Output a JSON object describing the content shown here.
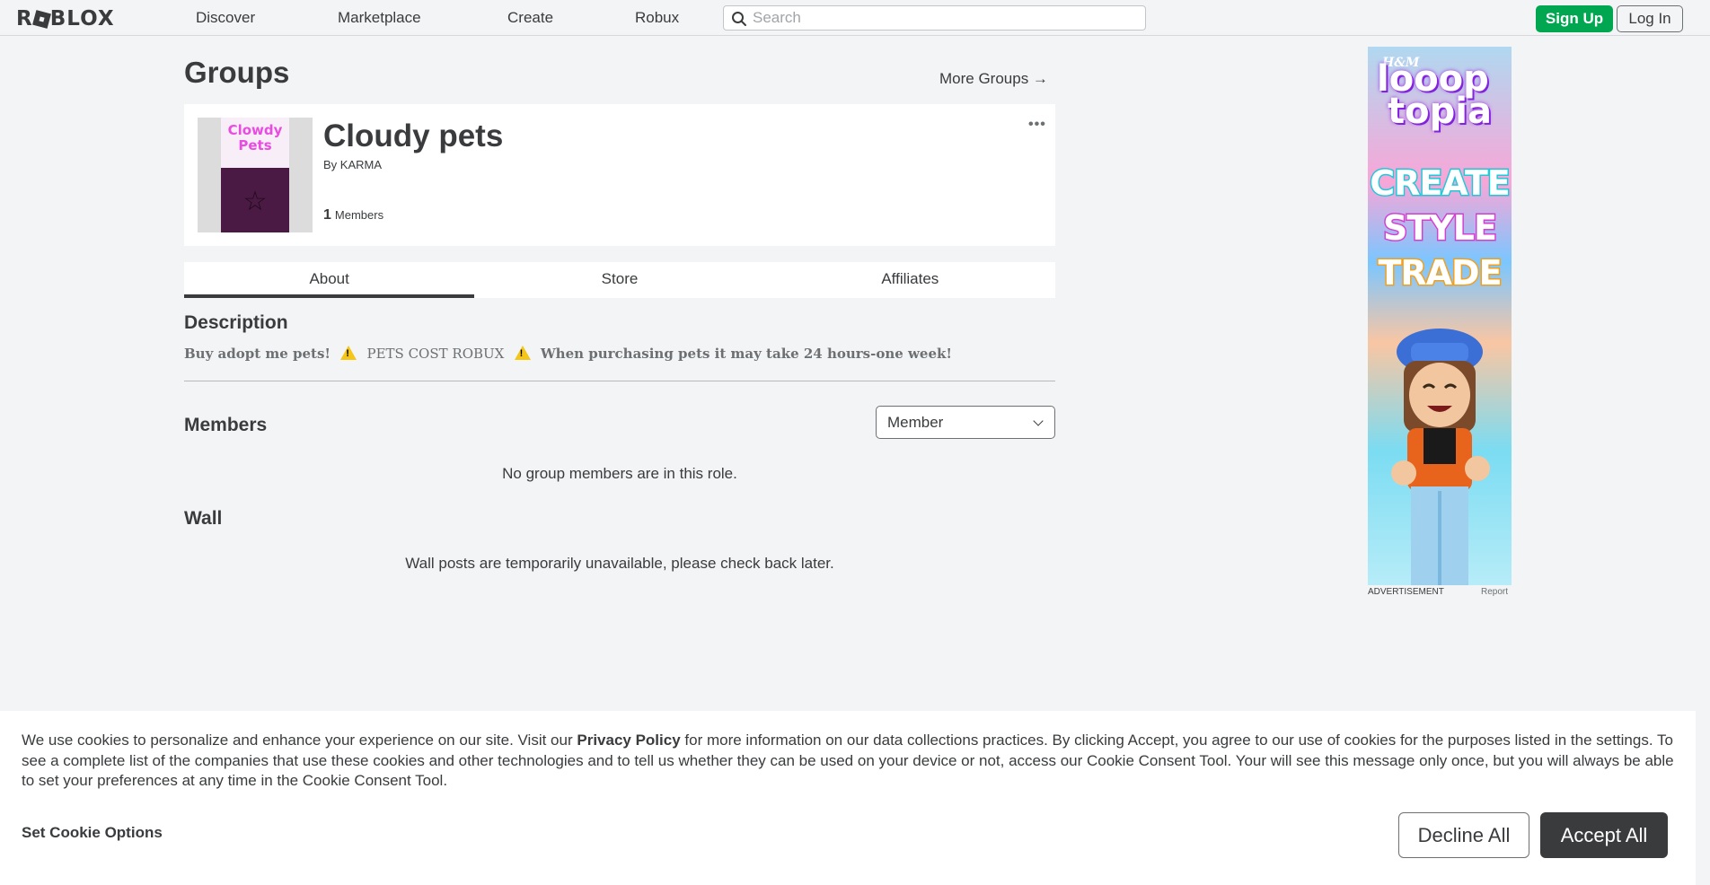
{
  "nav": {
    "logo": "ROBLOX",
    "links": [
      "Discover",
      "Marketplace",
      "Create",
      "Robux"
    ],
    "search_placeholder": "Search",
    "signup": "Sign Up",
    "login": "Log In"
  },
  "page": {
    "title": "Groups",
    "more_groups": "More Groups →"
  },
  "group": {
    "thumb_text": "Clowdy Pets",
    "name": "Cloudy pets",
    "by_prefix": "By",
    "owner": "KARMA",
    "member_count": "1",
    "members_label": "Members",
    "more_menu": "•••"
  },
  "tabs": [
    "About",
    "Store",
    "Affiliates"
  ],
  "about": {
    "description_heading": "Description",
    "description_part1": "Buy adopt me pets!",
    "description_part2": "PETS COST ROBUX",
    "description_part3": "When purchasing pets it may take 24 hours-one week!",
    "members_heading": "Members",
    "role_selected": "Member",
    "no_members": "No group members are in this role.",
    "wall_heading": "Wall",
    "wall_message": "Wall posts are temporarily unavailable, please check back later."
  },
  "ad": {
    "brand": "H&M",
    "logo_line1": "looop",
    "logo_line2": "topia",
    "words": [
      "CREATE",
      "STYLE",
      "TRADE"
    ],
    "caption": "ADVERTISEMENT",
    "report": "Report",
    "colors": {
      "create": "#1fc9d8",
      "style": "#d43fd1",
      "trade": "#f0a020"
    }
  },
  "cookie": {
    "text_before_link": "We use cookies to personalize and enhance your experience on our site. Visit our ",
    "link": "Privacy Policy",
    "text_after_link": " for more information on our data collections practices. By clicking Accept, you agree to our use of cookies for the purposes listed in the settings. To see a complete list of the companies that use these cookies and other technologies and to tell us whether they can be used on your device or not, access our Cookie Consent Tool. Your will see this message only once, but you will always be able to set your preferences at any time in the Cookie Consent Tool.",
    "set_options": "Set Cookie Options",
    "decline": "Decline All",
    "accept": "Accept All"
  },
  "colors": {
    "accent_green": "#00a650",
    "text_dark": "#393b3d",
    "background": "#f2f4f5"
  }
}
